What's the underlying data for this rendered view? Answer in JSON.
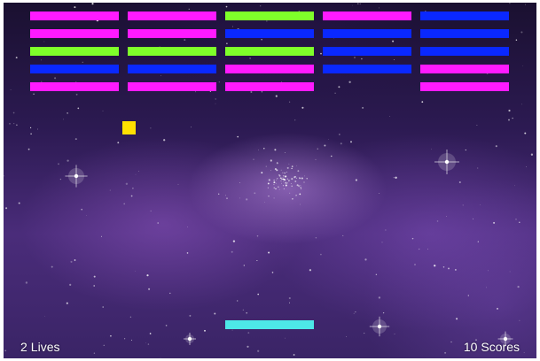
{
  "colors": {
    "magenta": "#ff1aff",
    "green": "#7fff2a",
    "blue": "#0a28ff",
    "ball": "#ffe000",
    "paddle": "#4de8e8"
  },
  "bricks": [
    [
      "magenta",
      "magenta",
      "green",
      "magenta",
      "blue"
    ],
    [
      "magenta",
      "magenta",
      "blue",
      "blue",
      "blue"
    ],
    [
      "green",
      "green",
      "green",
      "blue",
      "blue"
    ],
    [
      "blue",
      "blue",
      "magenta",
      "blue",
      "magenta"
    ],
    [
      "magenta",
      "magenta",
      "magenta",
      null,
      "magenta"
    ]
  ],
  "hud": {
    "lives": 2,
    "lives_label": "Lives",
    "score": 10,
    "score_label": "Scores"
  }
}
